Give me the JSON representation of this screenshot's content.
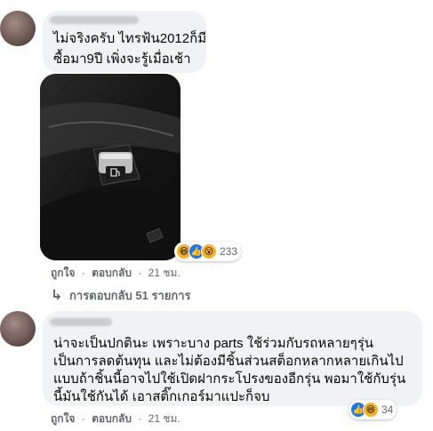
{
  "comment1": {
    "lines": [
      "ไม่จริงครับ ไทรฟ้น2012ก็มี",
      "ซื้อมา9ปี เพิ่งจะรู้เมื่อเช้า"
    ],
    "reaction_count": "233",
    "actions": {
      "like": "ถูกใจ",
      "reply": "ตอบกลับ",
      "time": "21 ชม."
    },
    "replies_label": "การตอบกลับ 51 รายการ"
  },
  "comment2": {
    "lines": [
      "น่าจะเป็นปกตินะ เพราะบาง parts ใช้ร่วมกับรถหลายๆรุ่น",
      "เป็นการลดต้นทุน และไม่ต้องมีชิ้นส่วนสต็อกหลากหลายเกินไป",
      "แบบถ้าชิ้นนี้อาจไปใช้เปิดฝากระโปรงของอีกรุ่น พอมาใช้กับรุ่น",
      "นี้มันใช้กันได้ เอาสติ๊กเกอร์มาแปะก็จบ"
    ],
    "reaction_count": "34",
    "actions": {
      "like": "ถูกใจ",
      "reply": "ตอบกลับ",
      "time": "21 ชม."
    }
  },
  "separator": "·",
  "reply_arrow": "↳",
  "reactions1": [
    "haha-icon",
    "like-icon",
    "wow-icon"
  ],
  "reactions2": [
    "like-icon",
    "haha-icon"
  ]
}
